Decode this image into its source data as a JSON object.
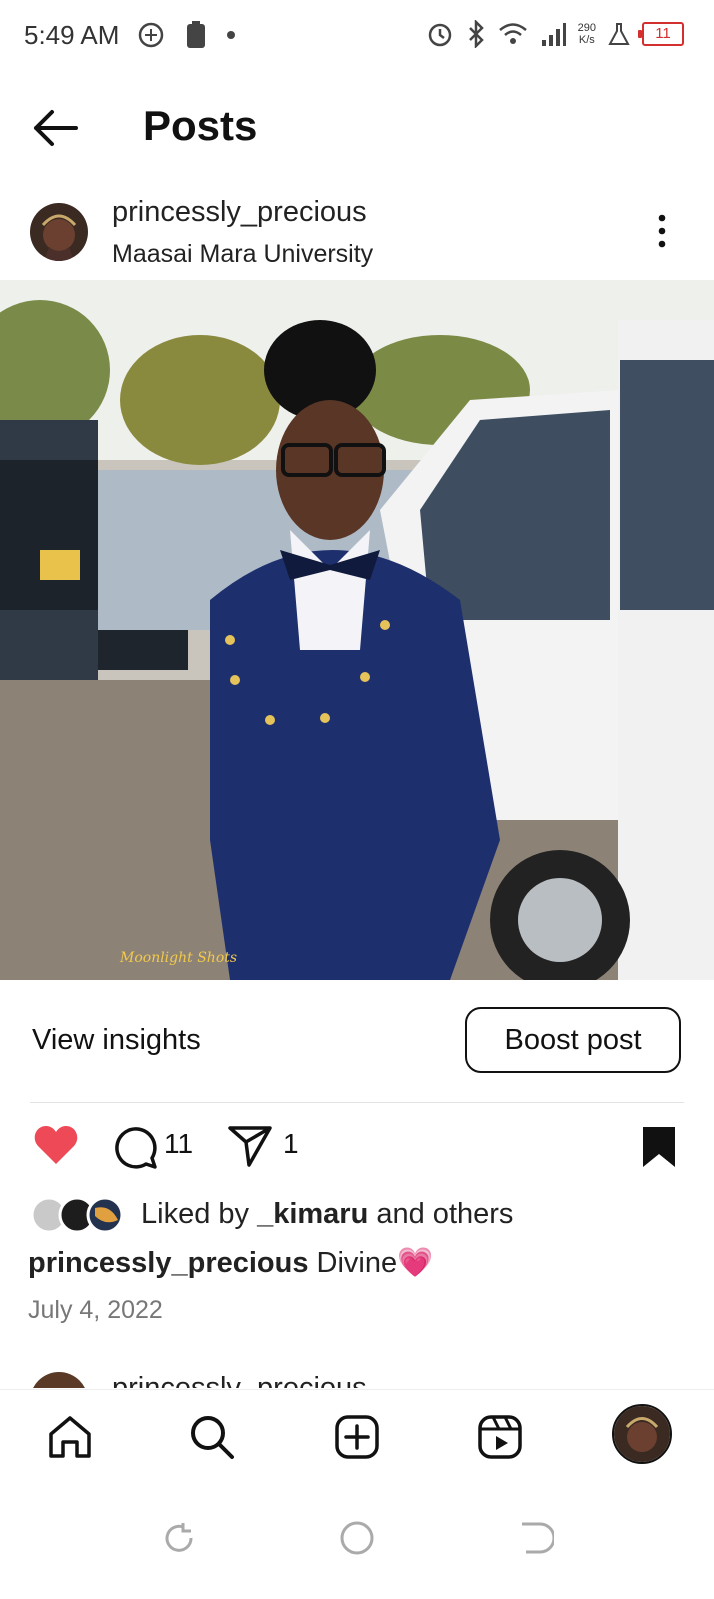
{
  "status_bar": {
    "time": "5:49 AM",
    "net_speed_value": "290",
    "net_speed_unit": "K/s",
    "battery": "11",
    "icons": [
      "chatgpt-icon",
      "battery-saver-icon",
      "dot-icon",
      "alarm-icon",
      "bluetooth-icon",
      "wifi-icon",
      "signal-icon",
      "flask-icon"
    ]
  },
  "header": {
    "title": "Posts",
    "back_icon": "arrow-left-icon"
  },
  "post": {
    "username": "princessly_precious",
    "location": "Maasai Mara University",
    "more_icon": "more-vertical-icon",
    "image_watermark": "Moonlight Shots",
    "view_insights": "View insights",
    "boost_post": "Boost post",
    "comment_count": "11",
    "share_count": "1",
    "liked_by_prefix": "Liked by ",
    "liked_by_user": "_kimaru",
    "liked_by_suffix": " and others",
    "caption_user": "princessly_precious",
    "caption_text": " Divine💗",
    "date": "July 4, 2022",
    "like_color": "#ed4956"
  },
  "next_post": {
    "username": "princessly_precious"
  },
  "bottom_nav": {
    "items": [
      "home-icon",
      "search-icon",
      "create-icon",
      "reels-icon",
      "profile-avatar"
    ]
  },
  "system_nav": {
    "items": [
      "recents-icon",
      "home-circle-icon",
      "back-icon"
    ]
  }
}
